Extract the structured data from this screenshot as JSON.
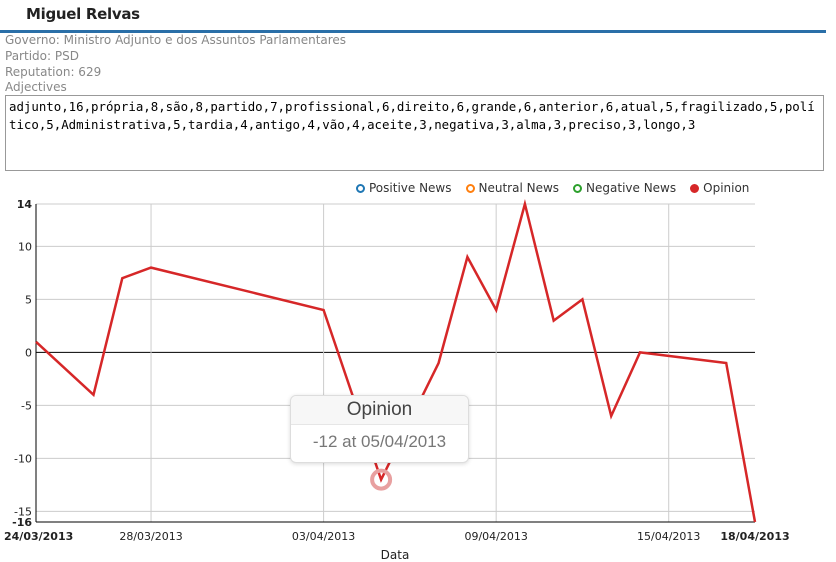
{
  "header": {
    "name": "Miguel Relvas"
  },
  "info": {
    "governo": "Governo: Ministro Adjunto e dos Assuntos Parlamentares",
    "partido": "Partido: PSD",
    "reputation": "Reputation: 629",
    "adjectives_label": "Adjectives"
  },
  "adjectives_text": "adjunto,16,própria,8,são,8,partido,7,profissional,6,direito,6,grande,6,anterior,6,atual,5,fragilizado,5,político,5,Administrativa,5,tardia,4,antigo,4,vão,4,aceite,3,negativa,3,alma,3,preciso,3,longo,3",
  "legend": [
    {
      "label": "Positive News",
      "color": "#1f77b4",
      "filled": false
    },
    {
      "label": "Neutral News",
      "color": "#ff7f0e",
      "filled": false
    },
    {
      "label": "Negative News",
      "color": "#2ca02c",
      "filled": false
    },
    {
      "label": "Opinion",
      "color": "#d62728",
      "filled": true
    }
  ],
  "tooltip": {
    "title": "Opinion",
    "body": "-12 at 05/04/2013"
  },
  "chart_data": {
    "type": "line",
    "xlabel": "Data",
    "ylabel": "",
    "ylim": [
      -16,
      14
    ],
    "xlim": [
      "24/03/2013",
      "18/04/2013"
    ],
    "y_ticks": [
      -16,
      -15,
      -10,
      -5,
      0,
      5,
      10,
      14
    ],
    "x_ticks": [
      "24/03/2013",
      "28/03/2013",
      "03/04/2013",
      "09/04/2013",
      "15/04/2013",
      "18/04/2013"
    ],
    "grid": true,
    "series": [
      {
        "name": "Opinion",
        "color": "#d62728",
        "points": [
          {
            "x": "24/03/2013",
            "y": 1
          },
          {
            "x": "26/03/2013",
            "y": -4
          },
          {
            "x": "27/03/2013",
            "y": 7
          },
          {
            "x": "28/03/2013",
            "y": 8
          },
          {
            "x": "03/04/2013",
            "y": 4
          },
          {
            "x": "05/04/2013",
            "y": -12
          },
          {
            "x": "07/04/2013",
            "y": -1
          },
          {
            "x": "08/04/2013",
            "y": 9
          },
          {
            "x": "09/04/2013",
            "y": 4
          },
          {
            "x": "10/04/2013",
            "y": 14
          },
          {
            "x": "11/04/2013",
            "y": 3
          },
          {
            "x": "12/04/2013",
            "y": 5
          },
          {
            "x": "13/04/2013",
            "y": -6
          },
          {
            "x": "14/04/2013",
            "y": 0
          },
          {
            "x": "17/04/2013",
            "y": -1
          },
          {
            "x": "18/04/2013",
            "y": -16
          }
        ]
      }
    ],
    "highlight": {
      "x": "05/04/2013",
      "y": -12
    }
  }
}
